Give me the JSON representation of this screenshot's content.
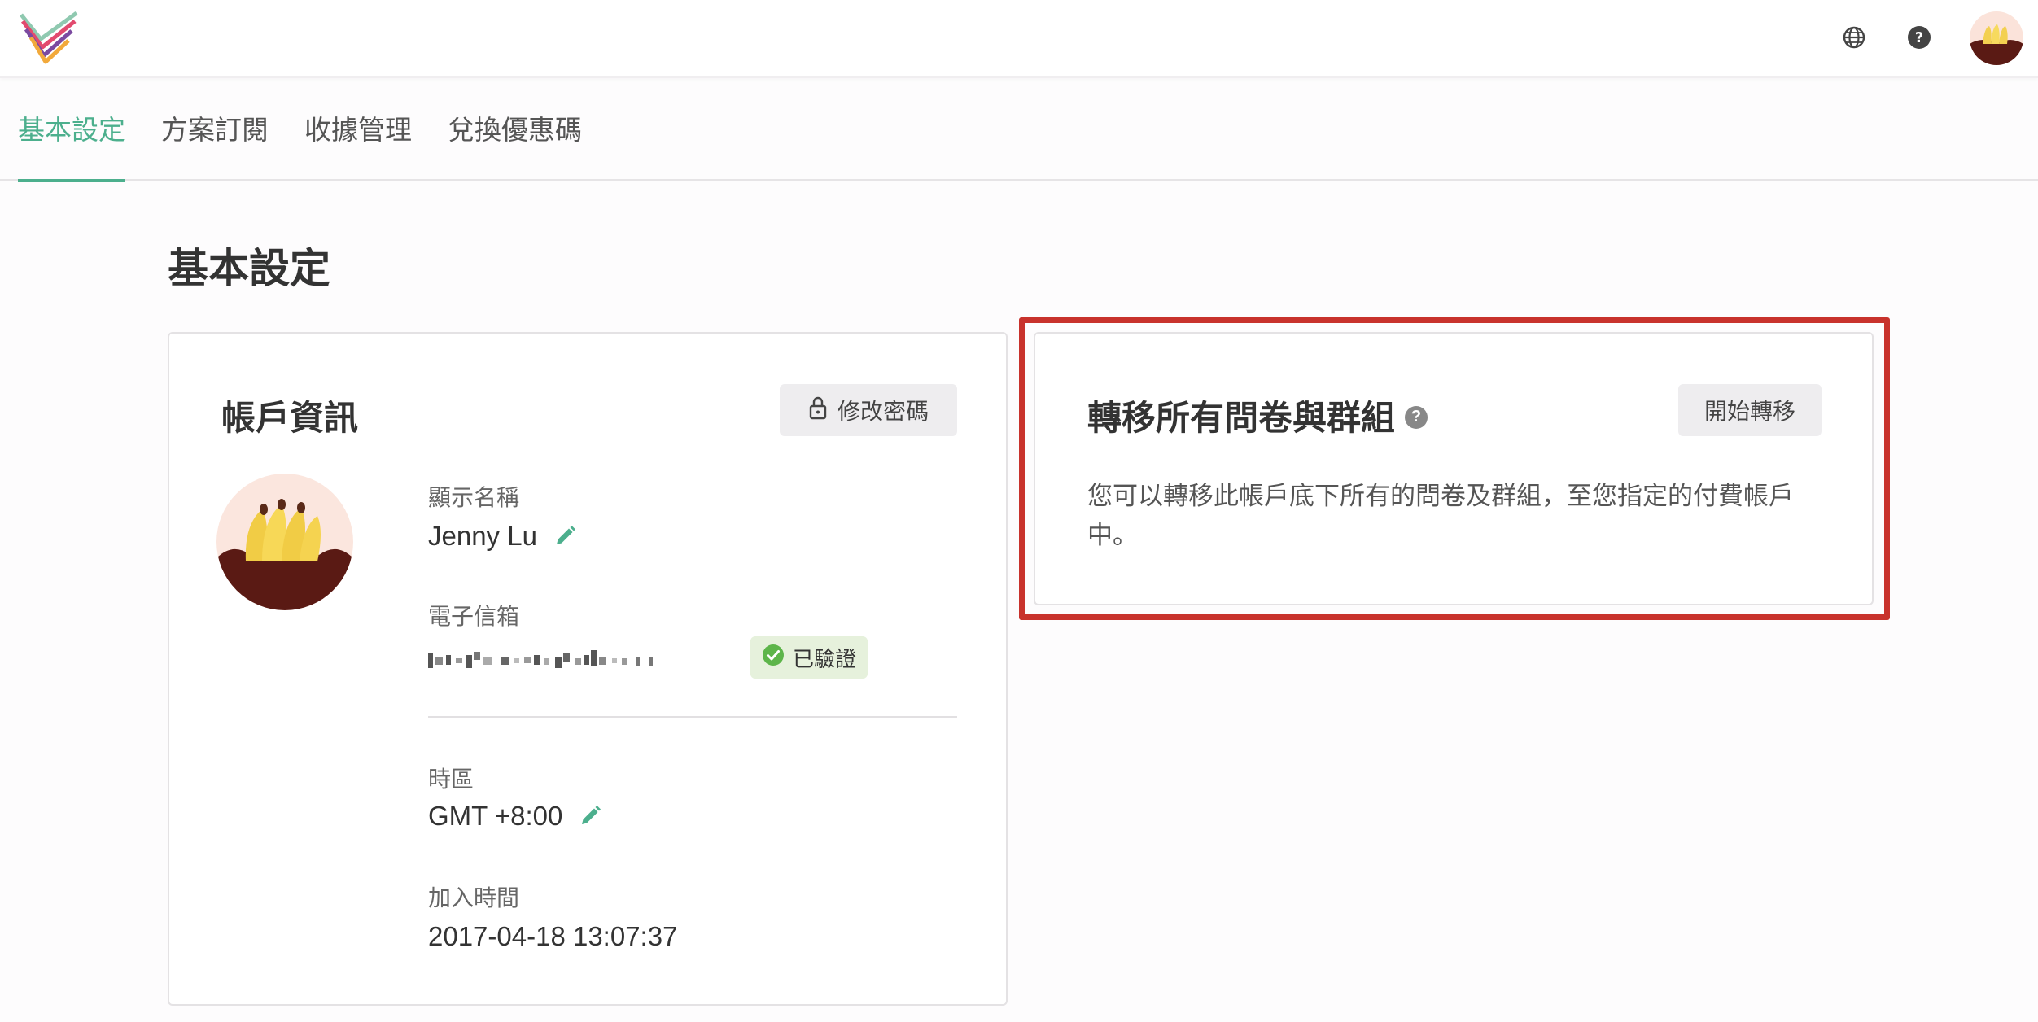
{
  "tabs": [
    {
      "label": "基本設定",
      "active": true
    },
    {
      "label": "方案訂閱",
      "active": false
    },
    {
      "label": "收據管理",
      "active": false
    },
    {
      "label": "兌換優惠碼",
      "active": false
    }
  ],
  "page": {
    "title": "基本設定"
  },
  "account": {
    "title": "帳戶資訊",
    "change_password_label": "修改密碼",
    "display_name_label": "顯示名稱",
    "display_name": "Jenny Lu",
    "email_label": "電子信箱",
    "verified_label": "已驗證",
    "timezone_label": "時區",
    "timezone": "GMT +8:00",
    "joined_label": "加入時間",
    "joined": "2017-04-18 13:07:37"
  },
  "transfer": {
    "title": "轉移所有問卷與群組",
    "help_mark": "?",
    "start_label": "開始轉移",
    "description": "您可以轉移此帳戶底下所有的問卷及群組，至您指定的付費帳戶中。"
  },
  "colors": {
    "accent": "#4caf8d",
    "highlight": "#c8322c",
    "verified_bg": "#e6f1dc"
  },
  "icons": [
    "logo-icon",
    "globe-icon",
    "help-icon",
    "lock-icon",
    "pencil-icon",
    "check-circle-icon"
  ]
}
